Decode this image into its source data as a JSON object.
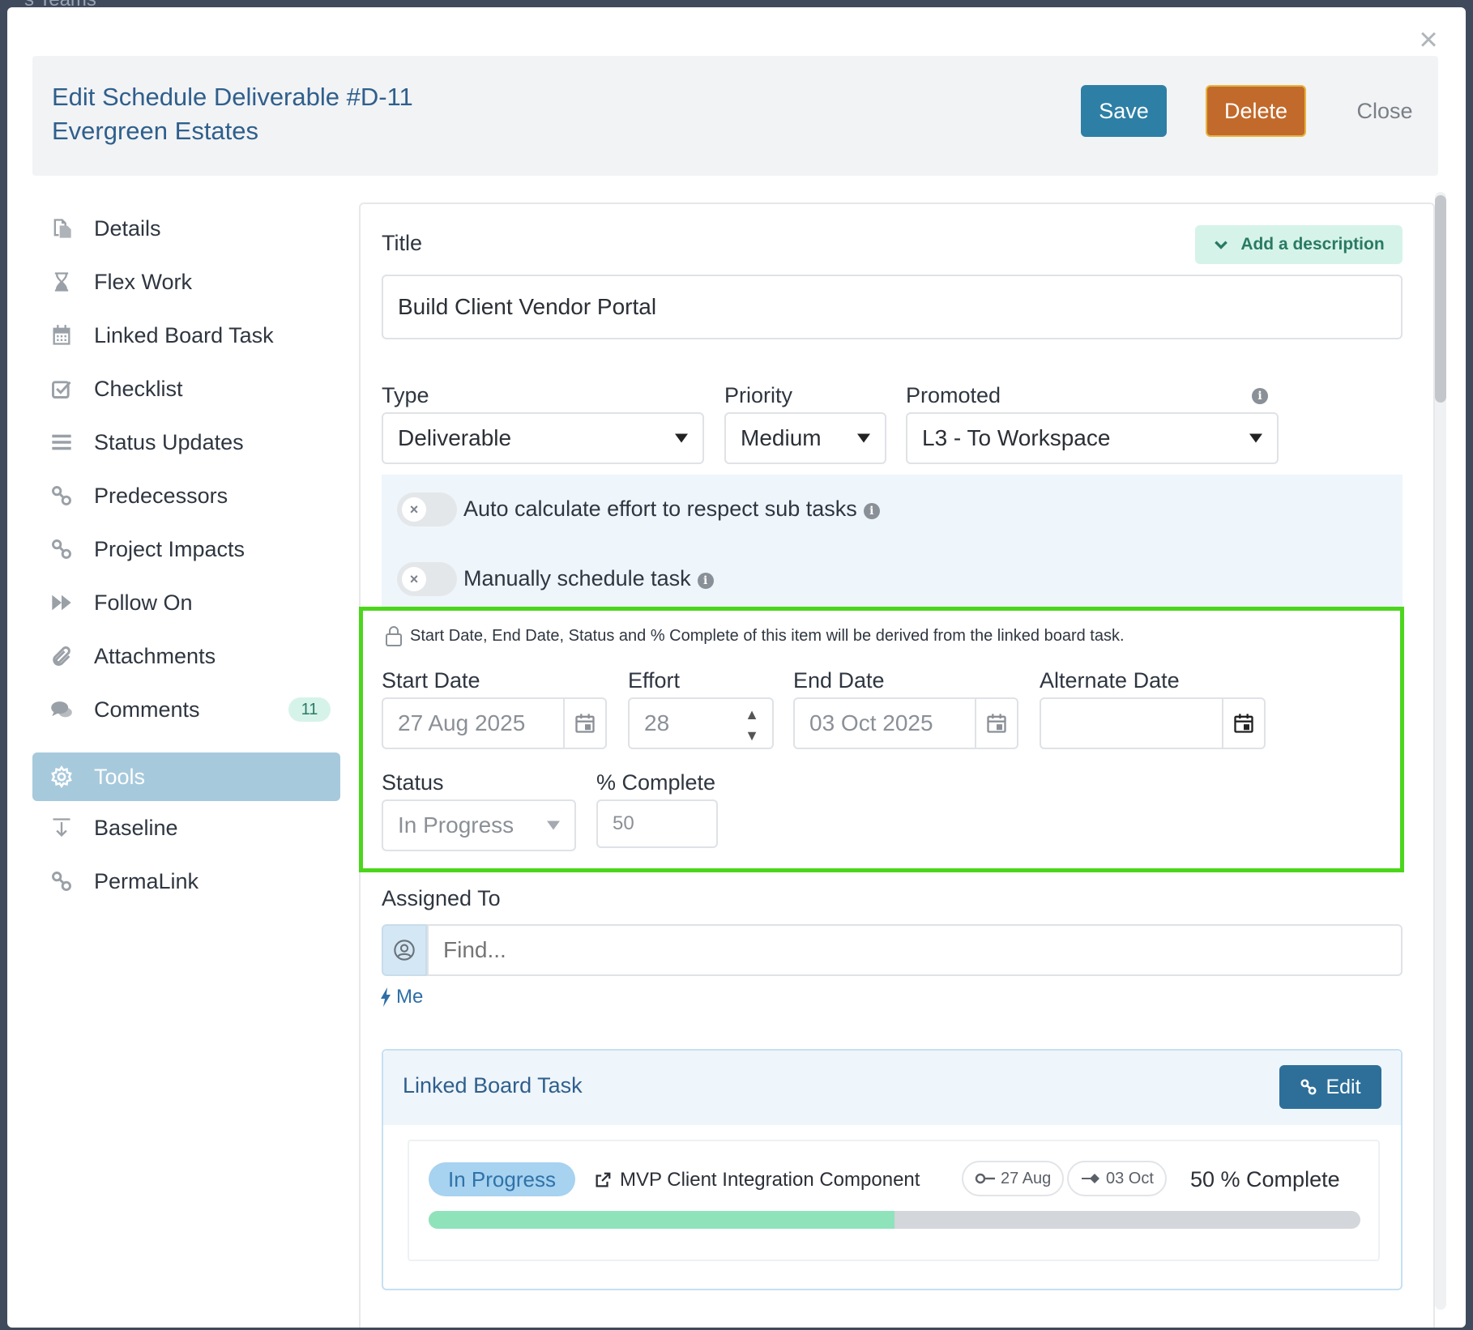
{
  "backdrop": {
    "text": "s Teams"
  },
  "header": {
    "title_line1": "Edit Schedule Deliverable #D-11",
    "title_line2": "Evergreen Estates",
    "save_label": "Save",
    "delete_label": "Delete",
    "close_label": "Close",
    "close_icon": "×"
  },
  "sidebar": {
    "items": [
      {
        "label": "Details",
        "icon": "file-copy-icon"
      },
      {
        "label": "Flex Work",
        "icon": "hourglass-icon"
      },
      {
        "label": "Linked Board Task",
        "icon": "calendar-icon"
      },
      {
        "label": "Checklist",
        "icon": "check-square-icon"
      },
      {
        "label": "Status Updates",
        "icon": "bars-icon"
      },
      {
        "label": "Predecessors",
        "icon": "link-icon"
      },
      {
        "label": "Project Impacts",
        "icon": "link-icon"
      },
      {
        "label": "Follow On",
        "icon": "fast-forward-icon"
      },
      {
        "label": "Attachments",
        "icon": "paperclip-icon"
      },
      {
        "label": "Comments",
        "icon": "comments-icon",
        "badge": "11"
      },
      {
        "label": "Tools",
        "icon": "gear-icon",
        "active": true
      },
      {
        "label": "Baseline",
        "icon": "baseline-icon"
      },
      {
        "label": "PermaLink",
        "icon": "link-icon"
      }
    ]
  },
  "form": {
    "title_label": "Title",
    "add_description_label": "Add a description",
    "title_value": "Build Client Vendor Portal",
    "type_label": "Type",
    "type_value": "Deliverable",
    "priority_label": "Priority",
    "priority_value": "Medium",
    "promoted_label": "Promoted",
    "promoted_value": "L3 - To Workspace",
    "auto_calc_label": "Auto calculate effort to respect sub tasks",
    "manual_schedule_label": "Manually schedule task",
    "derived_note": "Start Date, End Date, Status and % Complete of this item will be derived from the linked board task.",
    "start_date_label": "Start Date",
    "start_date_value": "27 Aug 2025",
    "effort_label": "Effort",
    "effort_value": "28",
    "end_date_label": "End Date",
    "end_date_value": "03 Oct 2025",
    "alternate_date_label": "Alternate Date",
    "alternate_date_value": "",
    "status_label": "Status",
    "status_value": "In Progress",
    "percent_label": "% Complete",
    "percent_value": "50",
    "assigned_label": "Assigned To",
    "assigned_placeholder": "Find...",
    "me_label": "Me"
  },
  "linked_board_task": {
    "heading": "Linked Board Task",
    "edit_label": "Edit",
    "status": "In Progress",
    "task_name": "MVP Client Integration Component",
    "start": "27 Aug",
    "end": "03 Oct",
    "percent_text": "50 % Complete",
    "progress_fraction": 0.5,
    "progress_color": "#8fe3bb"
  },
  "colors": {
    "accent": "#2d7fa6",
    "delete": "#c26a2b",
    "highlight_border": "#4bd61c",
    "active_nav": "#a7c9dc"
  }
}
